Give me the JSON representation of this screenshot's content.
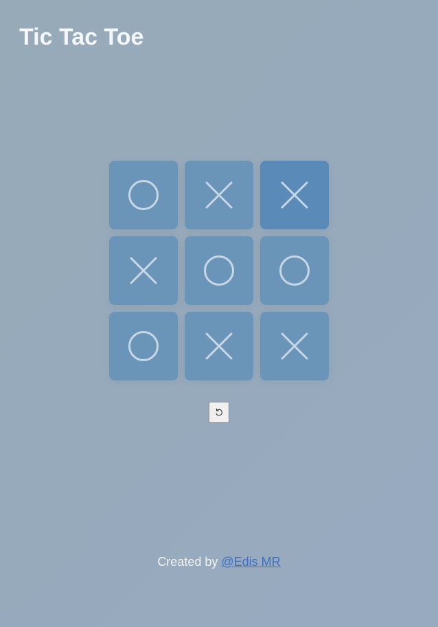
{
  "app": {
    "title": "Tic Tac Toe"
  },
  "board": {
    "cells": [
      "O",
      "X",
      "X",
      "X",
      "O",
      "O",
      "O",
      "X",
      "X"
    ],
    "highlighted_cell_index": 2
  },
  "controls": {
    "reset_icon": "undo-icon"
  },
  "footer": {
    "prefix": "Created by ",
    "author_link": "@Edis MR"
  },
  "colors": {
    "background": "#97aabb",
    "cell": "#6b95b8",
    "cell_highlight": "#5a8ab8",
    "mark": "#c6d7e6",
    "title": "#f4f7fb",
    "link": "#3d6fc4"
  }
}
